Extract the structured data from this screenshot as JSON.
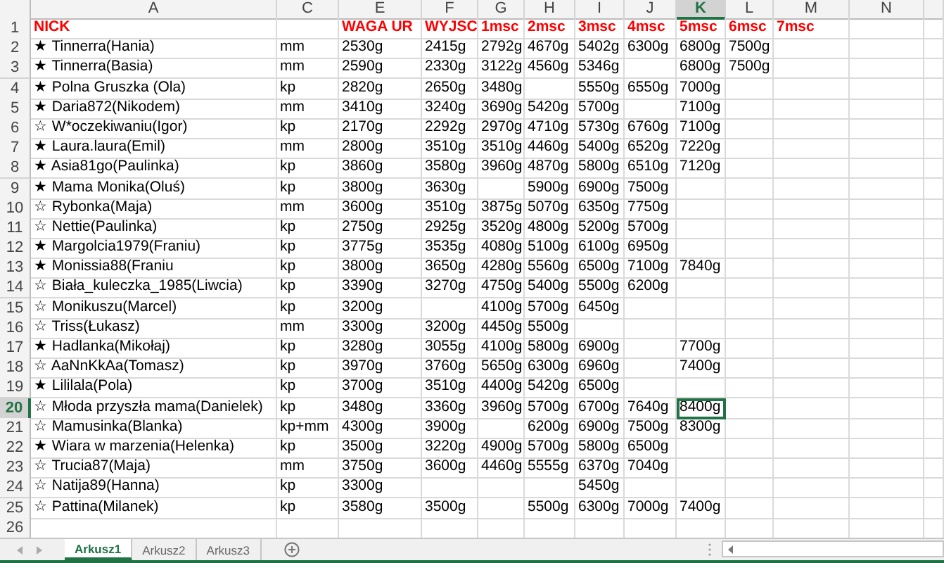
{
  "columns": [
    {
      "label": "A",
      "selected": false
    },
    {
      "label": "C",
      "selected": false
    },
    {
      "label": "E",
      "selected": false
    },
    {
      "label": "F",
      "selected": false
    },
    {
      "label": "G",
      "selected": false
    },
    {
      "label": "H",
      "selected": false
    },
    {
      "label": "I",
      "selected": false
    },
    {
      "label": "J",
      "selected": false
    },
    {
      "label": "K",
      "selected": true
    },
    {
      "label": "L",
      "selected": false
    },
    {
      "label": "M",
      "selected": false
    },
    {
      "label": "N",
      "selected": false
    }
  ],
  "rows": [
    {
      "number": "1",
      "kind": "heading",
      "selected": false,
      "cells": {
        "A": "NICK",
        "E": "WAGA UR",
        "F": "WYJSC",
        "G": "1msc",
        "H": "2msc",
        "I": "3msc",
        "J": "4msc",
        "K": "5msc",
        "L": "6msc",
        "M": "7msc"
      }
    },
    {
      "number": "2",
      "kind": "data",
      "selected": false,
      "cells": {
        "A": "★ Tinnerra(Hania)",
        "C": "mm",
        "E": "2530g",
        "F": "2415g",
        "G": "2792g",
        "H": "4670g",
        "I": "5402g",
        "J": "6300g",
        "K": "6800g",
        "L": "7500g"
      }
    },
    {
      "number": "3",
      "kind": "data",
      "selected": false,
      "cells": {
        "A": "★ Tinnerra(Basia)",
        "C": "mm",
        "E": "2590g",
        "F": "2330g",
        "G": "3122g",
        "H": "4560g",
        "I": "5346g",
        "K": "6800g",
        "L": "7500g"
      }
    },
    {
      "number": "4",
      "kind": "data",
      "selected": false,
      "cells": {
        "A": "★ Polna Gruszka (Ola)",
        "C": "kp",
        "E": "2820g",
        "F": "2650g",
        "G": "3480g",
        "I": "5550g",
        "J": "6550g",
        "K": "7000g"
      }
    },
    {
      "number": "5",
      "kind": "data",
      "selected": false,
      "cells": {
        "A": "★ Daria872(Nikodem)",
        "C": "mm",
        "E": "3410g",
        "F": "3240g",
        "G": "3690g",
        "H": "5420g",
        "I": "5700g",
        "K": "7100g"
      }
    },
    {
      "number": "6",
      "kind": "data",
      "selected": false,
      "cells": {
        "A": "☆ W*oczekiwaniu(Igor)",
        "C": "kp",
        "E": "2170g",
        "F": "2292g",
        "G": "2970g",
        "H": "4710g",
        "I": "5730g",
        "J": "6760g",
        "K": "7100g"
      }
    },
    {
      "number": "7",
      "kind": "data",
      "selected": false,
      "cells": {
        "A": "★ Laura.laura(Emil)",
        "C": "mm",
        "E": "2800g",
        "F": "3510g",
        "G": "3510g",
        "H": "4460g",
        "I": "5400g",
        "J": "6520g",
        "K": "7220g"
      }
    },
    {
      "number": "8",
      "kind": "data",
      "selected": false,
      "cells": {
        "A": "★ Asia81go(Paulinka)",
        "C": "kp",
        "E": "3860g",
        "F": "3580g",
        "G": "3960g",
        "H": "4870g",
        "I": "5800g",
        "J": "6510g",
        "K": "7120g"
      }
    },
    {
      "number": "9",
      "kind": "data",
      "selected": false,
      "cells": {
        "A": "★ Mama Monika(Oluś)",
        "C": "kp",
        "E": "3800g",
        "F": "3630g",
        "H": "5900g",
        "I": "6900g",
        "J": "7500g"
      }
    },
    {
      "number": "10",
      "kind": "data",
      "selected": false,
      "cells": {
        "A": "☆ Rybonka(Maja)",
        "C": "mm",
        "E": "3600g",
        "F": "3510g",
        "G": "3875g",
        "H": "5070g",
        "I": "6350g",
        "J": "7750g"
      }
    },
    {
      "number": "11",
      "kind": "data",
      "selected": false,
      "cells": {
        "A": "☆ Nettie(Paulinka)",
        "C": "kp",
        "E": "2750g",
        "F": "2925g",
        "G": "3520g",
        "H": "4800g",
        "I": "5200g",
        "J": "5700g"
      }
    },
    {
      "number": "12",
      "kind": "data",
      "selected": false,
      "cells": {
        "A": "★ Margolcia1979(Franiu)",
        "C": "kp",
        "E": "3775g",
        "F": "3535g",
        "G": "4080g",
        "H": "5100g",
        "I": "6100g",
        "J": "6950g"
      }
    },
    {
      "number": "13",
      "kind": "data",
      "selected": false,
      "cells": {
        "A": "★ Monissia88(Franiu",
        "C": "kp",
        "E": "3800g",
        "F": "3650g",
        "G": "4280g",
        "H": "5560g",
        "I": "6500g",
        "J": "7100g",
        "K": "7840g"
      }
    },
    {
      "number": "14",
      "kind": "data",
      "selected": false,
      "cells": {
        "A": "☆ Biała_kuleczka_1985(Liwcia)",
        "C": "kp",
        "E": "3390g",
        "F": "3270g",
        "G": "4750g",
        "H": "5400g",
        "I": "5500g",
        "J": "6200g"
      }
    },
    {
      "number": "15",
      "kind": "data",
      "selected": false,
      "cells": {
        "A": "☆ Monikuszu(Marcel)",
        "C": "kp",
        "E": "3200g",
        "G": "4100g",
        "H": "5700g",
        "I": "6450g"
      }
    },
    {
      "number": "16",
      "kind": "data",
      "selected": false,
      "cells": {
        "A": "☆ Triss(Łukasz)",
        "C": "mm",
        "E": "3300g",
        "F": "3200g",
        "G": "4450g",
        "H": "5500g"
      }
    },
    {
      "number": "17",
      "kind": "data",
      "selected": false,
      "cells": {
        "A": "★ Hadlanka(Mikołaj)",
        "C": "kp",
        "E": "3280g",
        "F": "3055g",
        "G": "4100g",
        "H": "5800g",
        "I": "6900g",
        "K": "7700g"
      }
    },
    {
      "number": "18",
      "kind": "data",
      "selected": false,
      "cells": {
        "A": "☆ AaNnKkAa(Tomasz)",
        "C": "kp",
        "E": "3970g",
        "F": "3760g",
        "G": "5650g",
        "H": "6300g",
        "I": "6960g",
        "K": "7400g"
      }
    },
    {
      "number": "19",
      "kind": "data",
      "selected": false,
      "cells": {
        "A": "★ Lililala(Pola)",
        "C": "kp",
        "E": "3700g",
        "F": "3510g",
        "G": "4400g",
        "H": "5420g",
        "I": "6500g"
      }
    },
    {
      "number": "20",
      "kind": "data",
      "selected": true,
      "cells": {
        "A": "☆ Młoda przyszła mama(Danielek)",
        "C": "kp",
        "E": "3480g",
        "F": "3360g",
        "G": "3960g",
        "H": "5700g",
        "I": "6700g",
        "J": "7640g",
        "K": "8400g"
      }
    },
    {
      "number": "21",
      "kind": "data",
      "selected": false,
      "cells": {
        "A": "☆ Mamusinka(Blanka)",
        "C": "kp+mm",
        "E": "4300g",
        "F": "3900g",
        "H": "6200g",
        "I": "6900g",
        "J": "7500g",
        "K": "8300g"
      }
    },
    {
      "number": "22",
      "kind": "data",
      "selected": false,
      "cells": {
        "A": "★ Wiara w marzenia(Helenka)",
        "C": "kp",
        "E": "3500g",
        "F": "3220g",
        "G": "4900g",
        "H": "5700g",
        "I": "5800g",
        "J": "6500g"
      }
    },
    {
      "number": "23",
      "kind": "data",
      "selected": false,
      "cells": {
        "A": "☆ Trucia87(Maja)",
        "C": "mm",
        "E": "3750g",
        "F": "3600g",
        "G": "4460g",
        "H": "5555g",
        "I": "6370g",
        "J": "7040g"
      }
    },
    {
      "number": "24",
      "kind": "data",
      "selected": false,
      "cells": {
        "A": "☆ Natija89(Hanna)",
        "C": "kp",
        "E": "3300g",
        "I": "5450g"
      }
    },
    {
      "number": "25",
      "kind": "data",
      "selected": false,
      "cells": {
        "A": "☆ Pattina(Milanek)",
        "C": "kp",
        "E": "3580g",
        "F": "3500g",
        "H": "5500g",
        "I": "6300g",
        "J": "7000g",
        "K": "7400g"
      }
    },
    {
      "number": "26",
      "kind": "data",
      "selected": false,
      "cells": {}
    }
  ],
  "sheets": [
    {
      "label": "Arkusz1",
      "selected": true
    },
    {
      "label": "Arkusz2",
      "selected": false
    },
    {
      "label": "Arkusz3",
      "selected": false
    }
  ]
}
